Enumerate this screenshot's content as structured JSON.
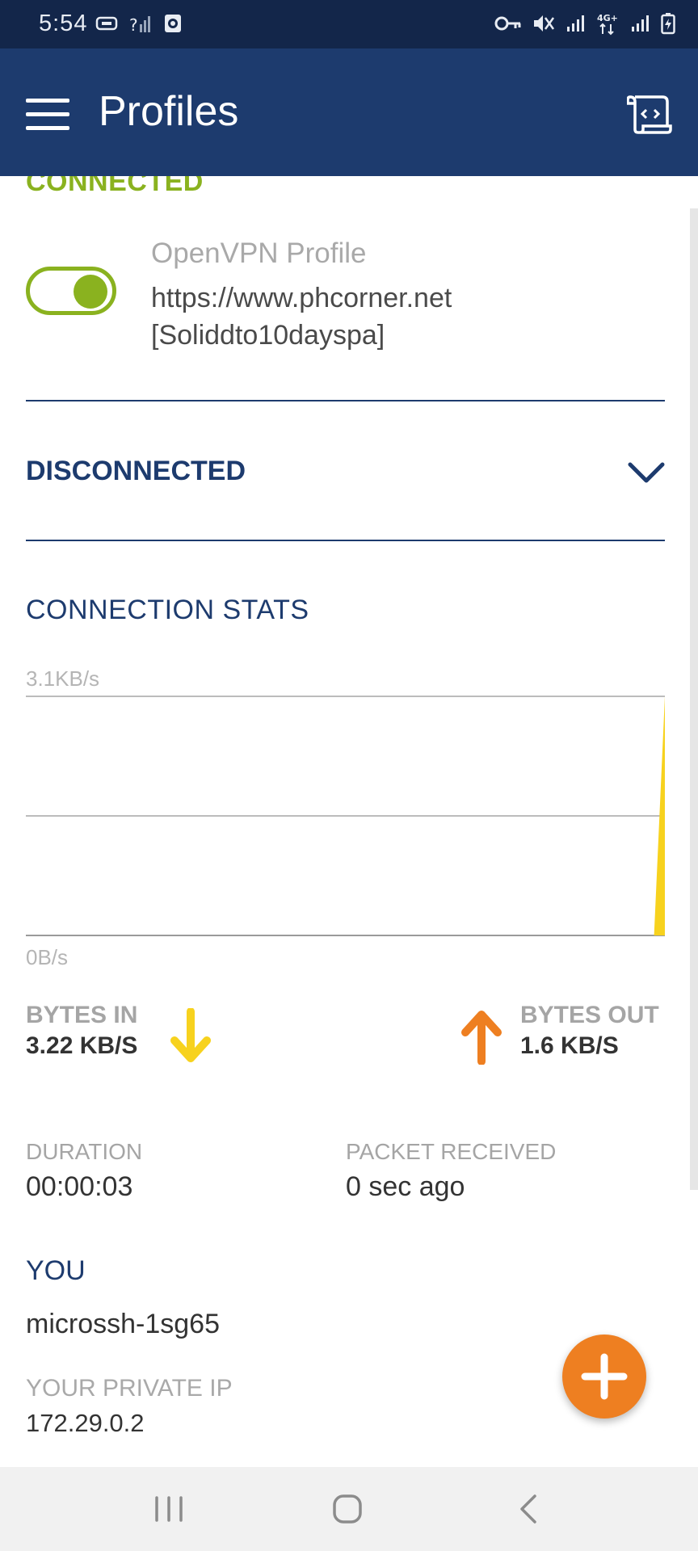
{
  "status_bar": {
    "time": "5:54",
    "left_icons": [
      "message-icon",
      "missed-signal-icon",
      "screen-record-icon"
    ],
    "right_icons": [
      "vpn-key-icon",
      "mute-icon",
      "signal-bars-icon",
      "signal-4g-icon",
      "signal-bars-icon",
      "battery-icon"
    ],
    "network_label": "4G+"
  },
  "app_bar": {
    "title": "Profiles",
    "menu_icon": "hamburger-menu-icon",
    "action_icon": "log-file-icon"
  },
  "profile": {
    "status": "CONNECTED",
    "type": "OpenVPN Profile",
    "name": "https://www.phcorner.net [Soliddto10dayspa]",
    "toggle_on": true
  },
  "connection_section": {
    "state": "DISCONNECTED",
    "expand_icon": "chevron-down-icon"
  },
  "stats": {
    "title": "CONNECTION STATS",
    "graph_max_label": "3.1KB/s",
    "graph_min_label": "0B/s",
    "bytes_in_label": "BYTES IN",
    "bytes_in_value": "3.22 KB/S",
    "bytes_out_label": "BYTES OUT",
    "bytes_out_value": "1.6 KB/S",
    "duration_label": "DURATION",
    "duration_value": "00:00:03",
    "packet_label": "PACKET RECEIVED",
    "packet_value": "0 sec ago"
  },
  "chart_data": {
    "type": "area",
    "ylim": [
      0,
      3.1
    ],
    "grid": true,
    "series": [
      {
        "color": "#f7d21e",
        "values": [
          0,
          0,
          0,
          0,
          0,
          0,
          0,
          0,
          0,
          0,
          0,
          0,
          0,
          0,
          0,
          0,
          0,
          0,
          0,
          0,
          0,
          0,
          0,
          0,
          0,
          0,
          0,
          0,
          0,
          0,
          0,
          0,
          0,
          0,
          0,
          0,
          0,
          0,
          0,
          0,
          0,
          0,
          0,
          0,
          0,
          0,
          0,
          0,
          0,
          0,
          0,
          0,
          0,
          0,
          0,
          0,
          0,
          0,
          0,
          3.1
        ]
      }
    ]
  },
  "you": {
    "title": "YOU",
    "hostname": "microssh-1sg65",
    "private_ip_label": "YOUR PRIVATE IP",
    "private_ip_value": "172.29.0.2"
  },
  "fab": {
    "icon": "plus-icon"
  },
  "nav_bar": {
    "icons": [
      "recent-apps-icon",
      "home-icon",
      "back-icon"
    ]
  },
  "colors": {
    "status_bar": "#13264a",
    "app_bar": "#1d3b6e",
    "accent_green": "#8ab21f",
    "bytes_in_yellow": "#f7d21e",
    "bytes_out_orange": "#ee7f21"
  }
}
